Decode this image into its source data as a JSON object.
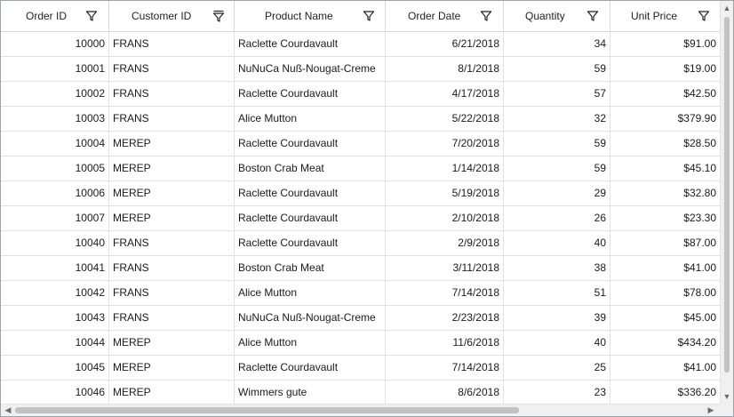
{
  "columns": [
    {
      "key": "orderid",
      "label": "Order ID"
    },
    {
      "key": "customerid",
      "label": "Customer ID"
    },
    {
      "key": "product",
      "label": "Product Name"
    },
    {
      "key": "orderdate",
      "label": "Order Date"
    },
    {
      "key": "quantity",
      "label": "Quantity"
    },
    {
      "key": "unitprice",
      "label": "Unit Price"
    }
  ],
  "rows": [
    {
      "orderid": "10000",
      "customerid": "FRANS",
      "product": "Raclette Courdavault",
      "orderdate": "6/21/2018",
      "quantity": "34",
      "unitprice": "$91.00"
    },
    {
      "orderid": "10001",
      "customerid": "FRANS",
      "product": "NuNuCa Nuß-Nougat-Creme",
      "orderdate": "8/1/2018",
      "quantity": "59",
      "unitprice": "$19.00"
    },
    {
      "orderid": "10002",
      "customerid": "FRANS",
      "product": "Raclette Courdavault",
      "orderdate": "4/17/2018",
      "quantity": "57",
      "unitprice": "$42.50"
    },
    {
      "orderid": "10003",
      "customerid": "FRANS",
      "product": "Alice Mutton",
      "orderdate": "5/22/2018",
      "quantity": "32",
      "unitprice": "$379.90"
    },
    {
      "orderid": "10004",
      "customerid": "MEREP",
      "product": "Raclette Courdavault",
      "orderdate": "7/20/2018",
      "quantity": "59",
      "unitprice": "$28.50"
    },
    {
      "orderid": "10005",
      "customerid": "MEREP",
      "product": "Boston Crab Meat",
      "orderdate": "1/14/2018",
      "quantity": "59",
      "unitprice": "$45.10"
    },
    {
      "orderid": "10006",
      "customerid": "MEREP",
      "product": "Raclette Courdavault",
      "orderdate": "5/19/2018",
      "quantity": "29",
      "unitprice": "$32.80"
    },
    {
      "orderid": "10007",
      "customerid": "MEREP",
      "product": "Raclette Courdavault",
      "orderdate": "2/10/2018",
      "quantity": "26",
      "unitprice": "$23.30"
    },
    {
      "orderid": "10040",
      "customerid": "FRANS",
      "product": "Raclette Courdavault",
      "orderdate": "2/9/2018",
      "quantity": "40",
      "unitprice": "$87.00"
    },
    {
      "orderid": "10041",
      "customerid": "FRANS",
      "product": "Boston Crab Meat",
      "orderdate": "3/11/2018",
      "quantity": "38",
      "unitprice": "$41.00"
    },
    {
      "orderid": "10042",
      "customerid": "FRANS",
      "product": "Alice Mutton",
      "orderdate": "7/14/2018",
      "quantity": "51",
      "unitprice": "$78.00"
    },
    {
      "orderid": "10043",
      "customerid": "FRANS",
      "product": "NuNuCa Nuß-Nougat-Creme",
      "orderdate": "2/23/2018",
      "quantity": "39",
      "unitprice": "$45.00"
    },
    {
      "orderid": "10044",
      "customerid": "MEREP",
      "product": "Alice Mutton",
      "orderdate": "11/6/2018",
      "quantity": "40",
      "unitprice": "$434.20"
    },
    {
      "orderid": "10045",
      "customerid": "MEREP",
      "product": "Raclette Courdavault",
      "orderdate": "7/14/2018",
      "quantity": "25",
      "unitprice": "$41.00"
    },
    {
      "orderid": "10046",
      "customerid": "MEREP",
      "product": "Wimmers gute",
      "orderdate": "8/6/2018",
      "quantity": "23",
      "unitprice": "$336.20"
    }
  ],
  "icons": {
    "filter": "filter-funnel-icon",
    "filter_active": "filter-active-icon",
    "scroll_up": "scroll-up-arrow-icon",
    "scroll_down": "scroll-down-arrow-icon",
    "scroll_left": "scroll-left-arrow-icon",
    "scroll_right": "scroll-right-arrow-icon"
  },
  "colors": {
    "header_text": "#222222",
    "grid_line": "#dfe3e8",
    "scrollbar_thumb": "#c2c2c2"
  },
  "filter_state": {
    "customerid": "active"
  }
}
